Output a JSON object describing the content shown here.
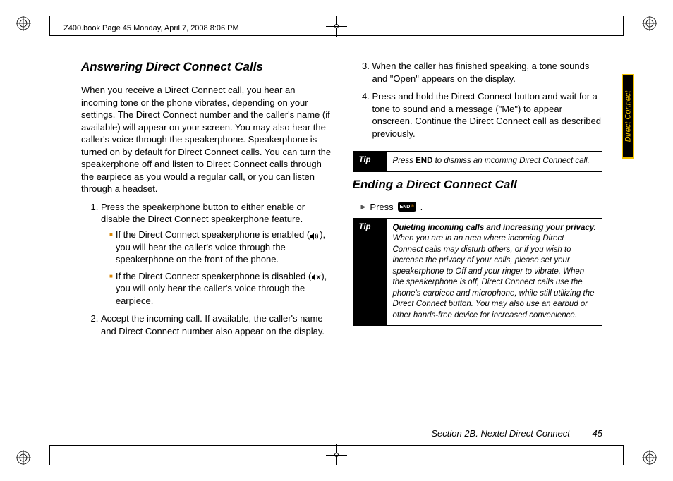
{
  "meta": {
    "header": "Z400.book  Page 45  Monday, April 7, 2008  8:06 PM",
    "side_tab": "Direct Connect"
  },
  "left": {
    "heading": "Answering Direct Connect Calls",
    "intro": "When you receive a Direct Connect call, you hear an incoming tone or the phone vibrates, depending on your settings. The Direct Connect number and the caller's name (if available) will appear on your screen. You may also hear the caller's voice through the speakerphone. Speakerphone is turned on by default for Direct Connect calls. You can turn the speakerphone off and listen to Direct Connect calls through the earpiece as you would a regular call, or you can listen through a headset.",
    "step1": "Press the speakerphone button to either enable or disable the Direct Connect speakerphone feature.",
    "step1a_pre": "If the Direct Connect speakerphone is enabled (",
    "step1a_post": "), you will hear the caller's voice through the speakerphone on the front of the phone.",
    "step1b_pre": "If the Direct Connect speakerphone is disabled (",
    "step1b_post": "), you will only hear the caller's voice through the earpiece.",
    "step2": "Accept the incoming call. If available, the caller's name and Direct Connect number also appear on the display."
  },
  "right": {
    "step3": "When the caller has finished speaking, a tone sounds and \"Open\" appears on the display.",
    "step4": "Press and hold the Direct Connect button and wait for a tone to sound and a message (\"Me\") to appear onscreen. Continue the Direct Connect call as described previously.",
    "tip1_label": "Tip",
    "tip1_pre": "Press ",
    "tip1_bold": "END",
    "tip1_post": " to dismiss an incoming Direct Connect call.",
    "heading2": "Ending a Direct Connect Call",
    "press_label": "Press",
    "press_period": ".",
    "tip2_label": "Tip",
    "tip2_lead": "Quieting incoming calls and increasing your privacy.",
    "tip2_body": " When you are in an area where incoming Direct Connect calls may disturb others, or if you wish to increase the privacy of your calls, please set your speakerphone to Off and your ringer to vibrate. When the speakerphone is off, Direct Connect calls use the phone's earpiece and microphone, while still utilizing the Direct Connect button. You may also use an earbud or other hands-free device for increased convenience."
  },
  "footer": {
    "section": "Section 2B. Nextel Direct Connect",
    "page": "45"
  }
}
